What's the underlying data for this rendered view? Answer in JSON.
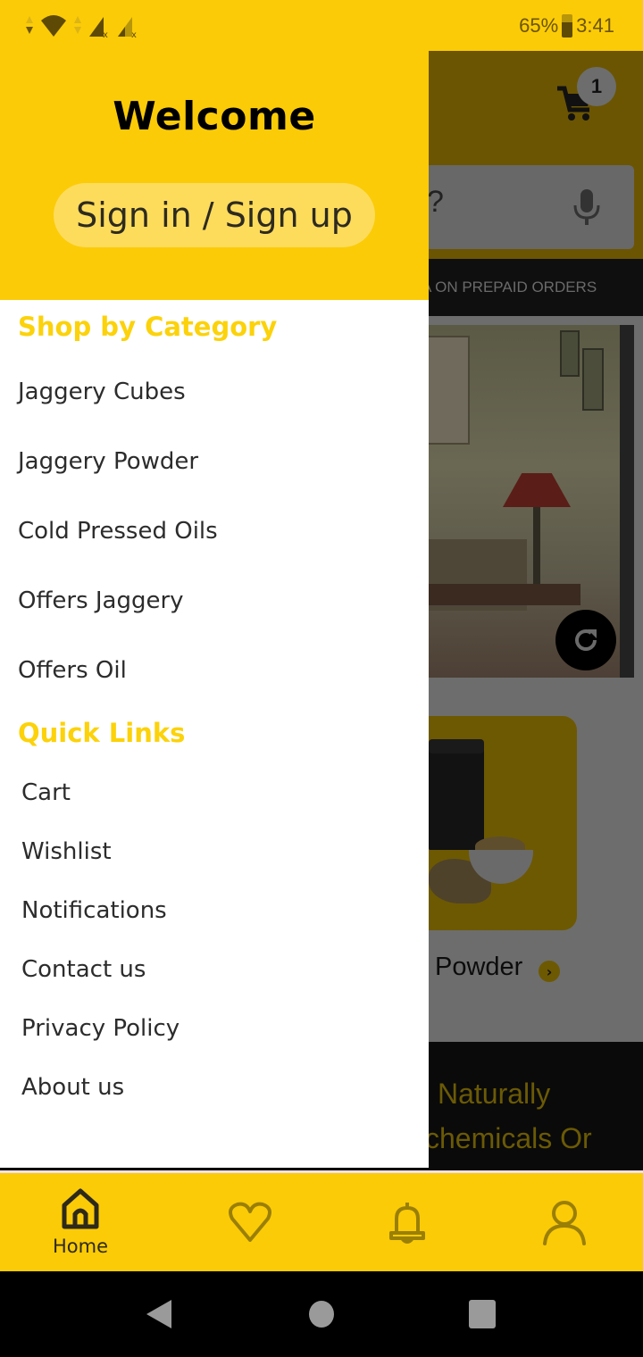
{
  "status_bar": {
    "battery_percent": "65%",
    "time": "3:41",
    "icons": [
      "data-arrows-icon",
      "wifi-icon",
      "signal-icon-sim1",
      "signal-icon-sim2"
    ]
  },
  "background_page": {
    "cart_badge_count": "1",
    "search_placeholder_fragment": "?",
    "promo_text": "A ON PREPAID ORDERS",
    "product_label": "Powder",
    "marketing_line1": "Naturally",
    "marketing_line2": "chemicals Or"
  },
  "drawer": {
    "welcome": "Welcome",
    "sign_in_label": "Sign in / Sign up",
    "category_title": "Shop by Category",
    "categories": [
      {
        "label": "Jaggery Cubes"
      },
      {
        "label": "Jaggery Powder"
      },
      {
        "label": "Cold Pressed Oils"
      },
      {
        "label": "Offers Jaggery"
      },
      {
        "label": "Offers Oil"
      }
    ],
    "quick_links_title": "Quick Links",
    "quick_links": [
      {
        "label": "Cart"
      },
      {
        "label": "Wishlist"
      },
      {
        "label": "Notifications"
      },
      {
        "label": "Contact us"
      },
      {
        "label": "Privacy Policy"
      },
      {
        "label": "About us"
      }
    ]
  },
  "bottom_nav": {
    "items": [
      {
        "label": "Home",
        "icon": "home-icon",
        "active": true
      },
      {
        "label": "",
        "icon": "heart-icon",
        "active": false
      },
      {
        "label": "",
        "icon": "bell-icon",
        "active": false
      },
      {
        "label": "",
        "icon": "user-icon",
        "active": false
      }
    ]
  },
  "colors": {
    "brand_yellow": "#fbcb07",
    "section_title_yellow": "#fcd20a",
    "sign_in_button_bg": "#fddc5c",
    "text_dark": "#2c2c2c"
  }
}
